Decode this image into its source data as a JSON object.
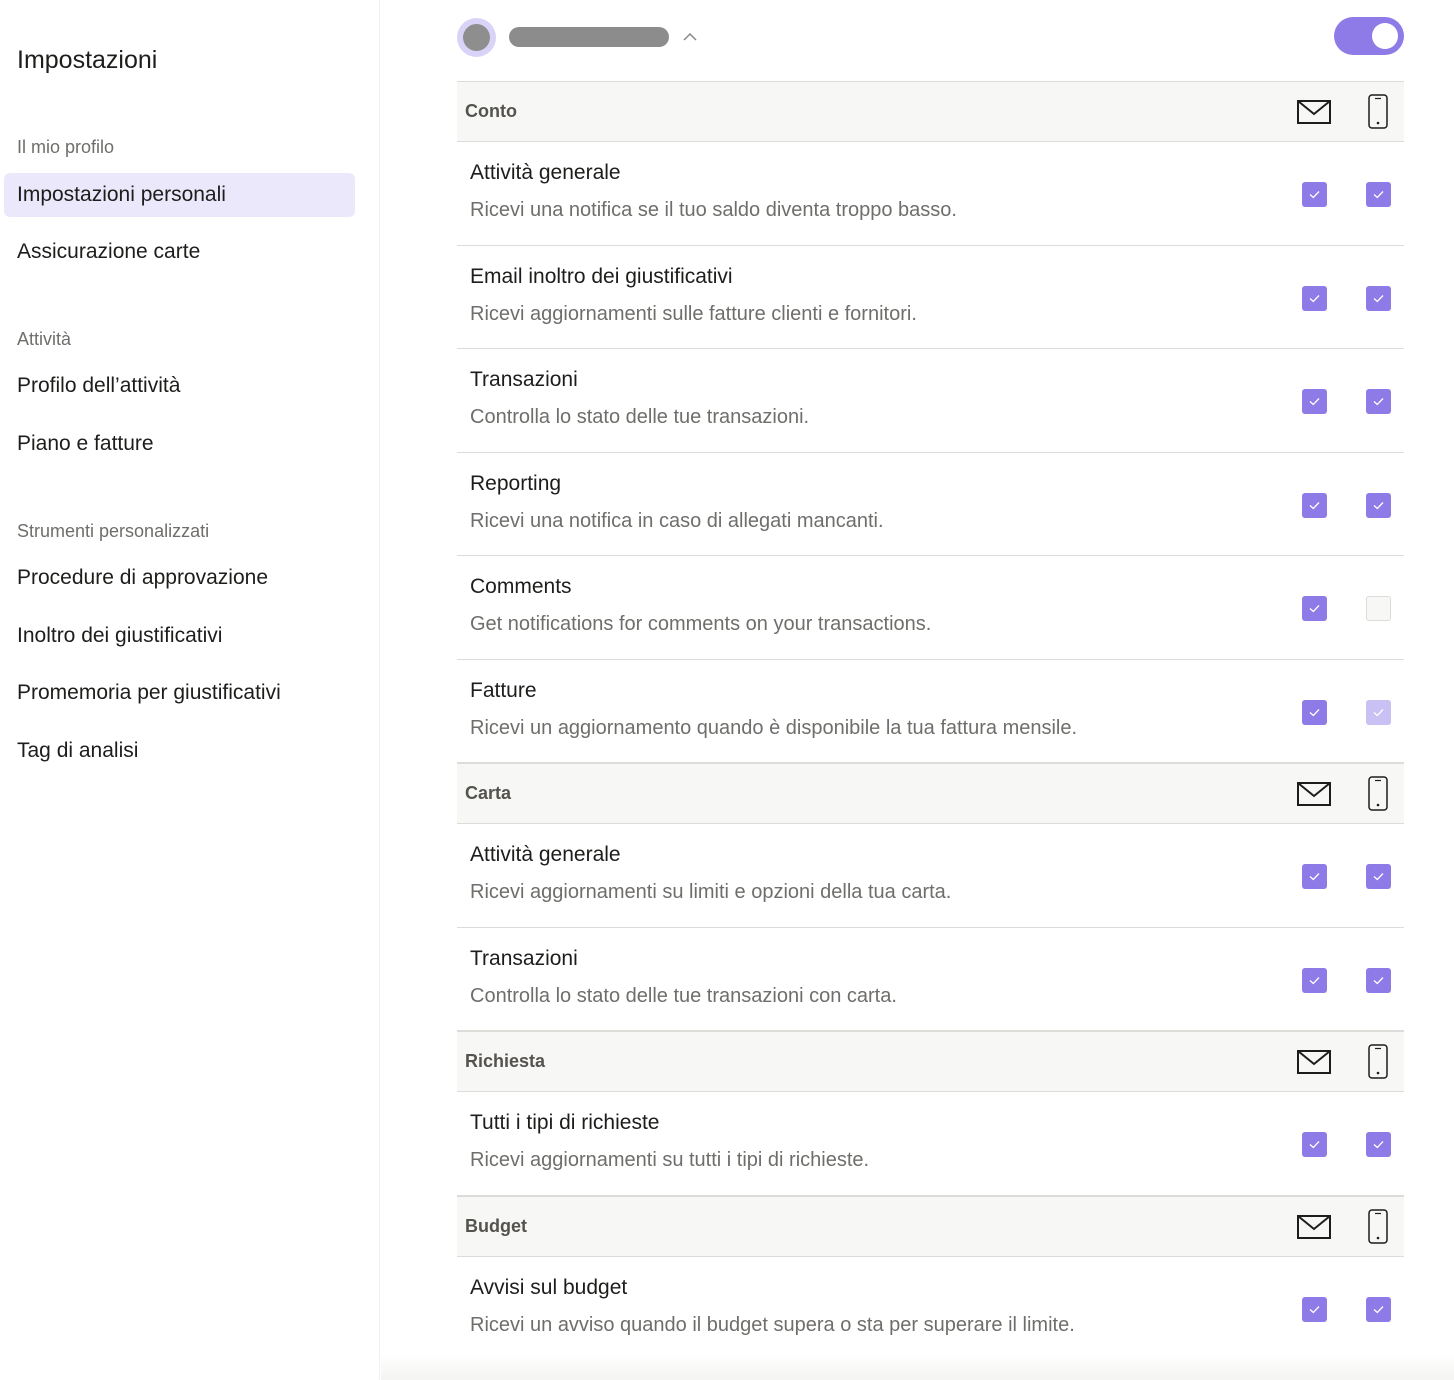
{
  "sidebar": {
    "title": "Impostazioni",
    "sections": [
      {
        "label": "Il mio profilo",
        "items": [
          {
            "label": "Impostazioni personali",
            "active": true
          },
          {
            "label": "Assicurazione carte",
            "active": false
          }
        ]
      },
      {
        "label": "Attività",
        "items": [
          {
            "label": "Profilo dell’attività",
            "active": false
          },
          {
            "label": "Piano e fatture",
            "active": false
          }
        ]
      },
      {
        "label": "Strumenti personalizzati",
        "items": [
          {
            "label": "Procedure di approvazione",
            "active": false
          },
          {
            "label": "Inoltro dei giustificativi",
            "active": false
          },
          {
            "label": "Promemoria per giustificativi",
            "active": false
          },
          {
            "label": "Tag di analisi",
            "active": false
          }
        ]
      }
    ]
  },
  "header": {
    "toggle_on": true,
    "chevron_icon": "chevron-up-icon"
  },
  "colors": {
    "accent": "#8e7be8",
    "accent_light": "#ece8fb",
    "disabled_check": "#c9c0f3",
    "header_bg": "#f7f7f5"
  },
  "groups": [
    {
      "title": "Conto",
      "email_icon": "mail-icon",
      "mobile_icon": "phone-icon",
      "rows": [
        {
          "title": "Attività generale",
          "desc": "Ricevi una notifica se il tuo saldo diventa troppo basso.",
          "email": "checked",
          "mobile": "checked"
        },
        {
          "title": "Email inoltro dei giustificativi",
          "desc": "Ricevi aggiornamenti sulle fatture clienti e fornitori.",
          "email": "checked",
          "mobile": "checked"
        },
        {
          "title": "Transazioni",
          "desc": "Controlla lo stato delle tue transazioni.",
          "email": "checked",
          "mobile": "checked"
        },
        {
          "title": "Reporting",
          "desc": "Ricevi una notifica in caso di allegati mancanti.",
          "email": "checked",
          "mobile": "checked"
        },
        {
          "title": "Comments",
          "desc": "Get notifications for comments on your transactions.",
          "email": "checked",
          "mobile": "unchecked"
        },
        {
          "title": "Fatture",
          "desc": "Ricevi un aggiornamento quando è disponibile la tua fattura mensile.",
          "email": "checked",
          "mobile": "disabled"
        }
      ]
    },
    {
      "title": "Carta",
      "email_icon": "mail-icon",
      "mobile_icon": "phone-icon",
      "rows": [
        {
          "title": "Attività generale",
          "desc": "Ricevi aggiornamenti su limiti e opzioni della tua carta.",
          "email": "checked",
          "mobile": "checked"
        },
        {
          "title": "Transazioni",
          "desc": "Controlla lo stato delle tue transazioni con carta.",
          "email": "checked",
          "mobile": "checked"
        }
      ]
    },
    {
      "title": "Richiesta",
      "email_icon": "mail-icon",
      "mobile_icon": "phone-icon",
      "rows": [
        {
          "title": "Tutti i tipi di richieste",
          "desc": "Ricevi aggiornamenti su tutti i tipi di richieste.",
          "email": "checked",
          "mobile": "checked"
        }
      ]
    },
    {
      "title": "Budget",
      "email_icon": "mail-icon",
      "mobile_icon": "phone-icon",
      "rows": [
        {
          "title": "Avvisi sul budget",
          "desc": "Ricevi un avviso quando il budget supera o sta per superare il limite.",
          "email": "checked",
          "mobile": "checked"
        }
      ]
    }
  ]
}
